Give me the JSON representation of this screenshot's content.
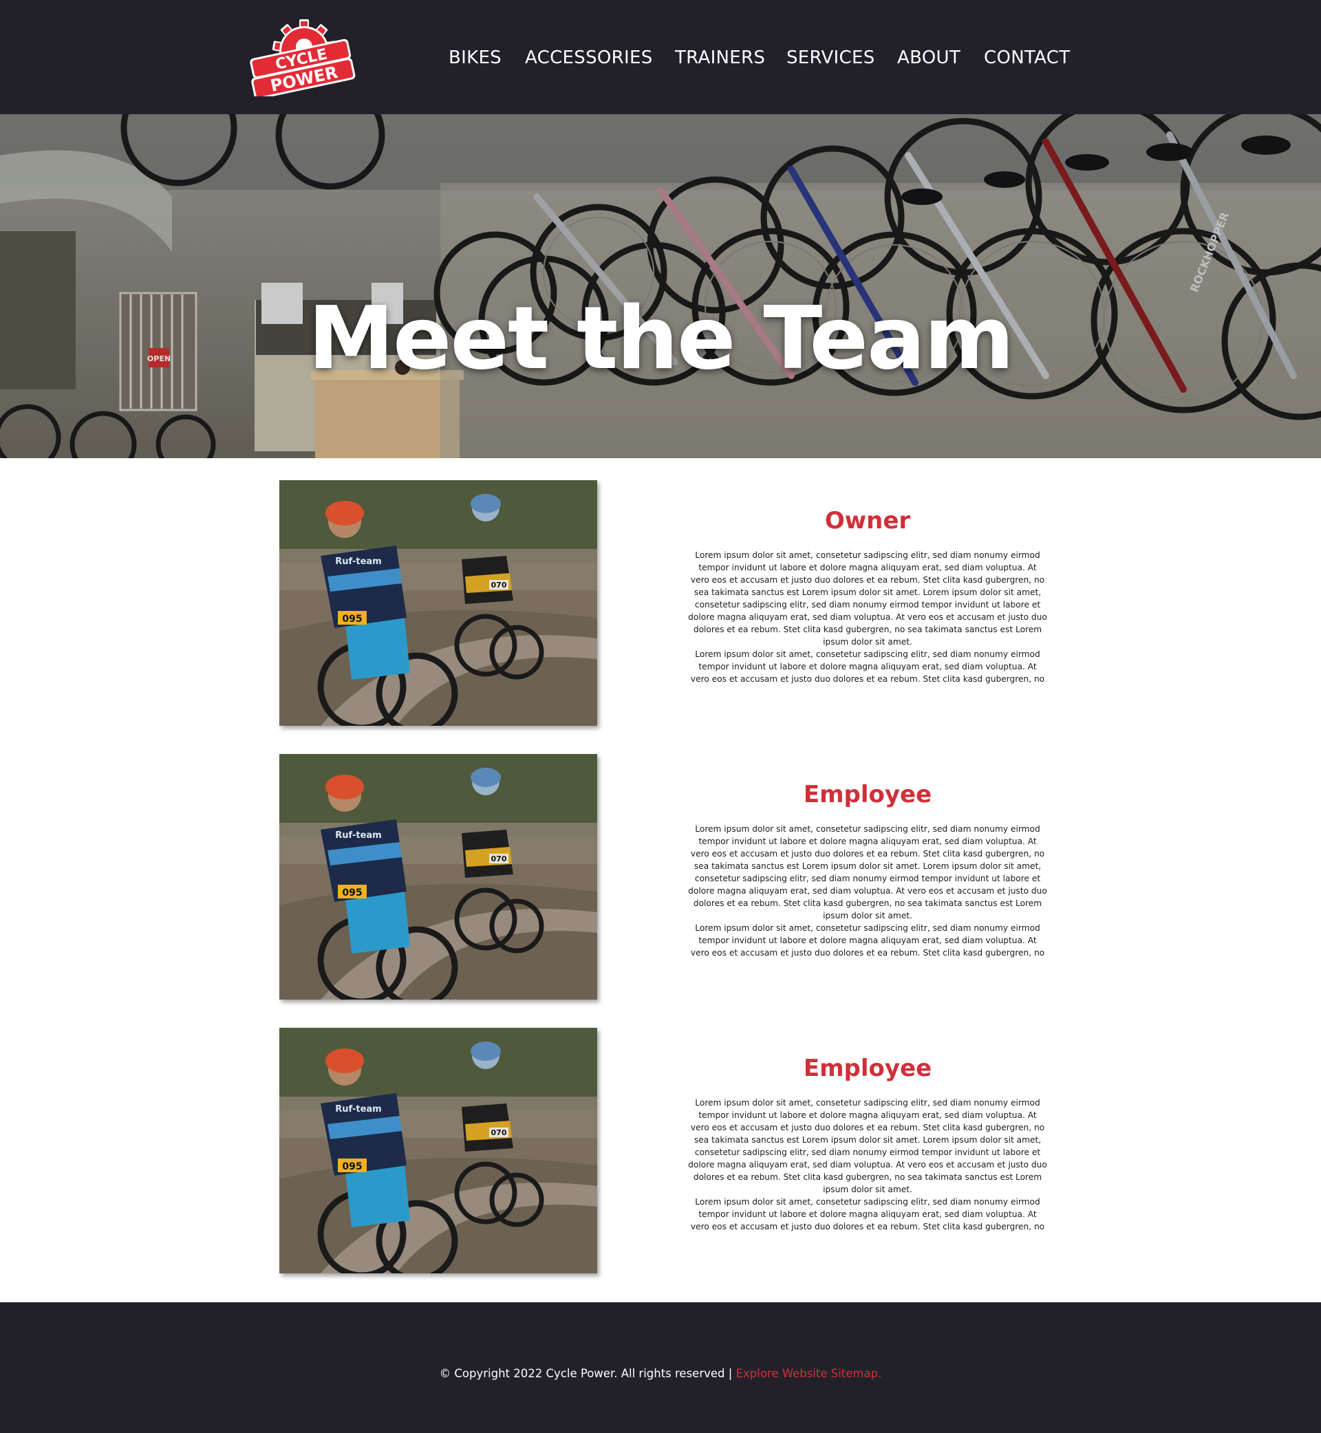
{
  "brand": {
    "logo_line1": "CYCLE",
    "logo_line2": "POWER",
    "color": "#e32b36"
  },
  "nav": {
    "items": [
      {
        "label": "BIKES"
      },
      {
        "label": "ACCESSORIES"
      },
      {
        "label": "TRAINERS"
      },
      {
        "label": "SERVICES"
      },
      {
        "label": "ABOUT"
      },
      {
        "label": "CONTACT"
      }
    ]
  },
  "hero": {
    "title": "Meet the Team",
    "sign_text": "OPEN",
    "rim_text": "ROCKHOPPER"
  },
  "team": [
    {
      "role": "Owner",
      "rider1_plate": "095",
      "rider2_plate": "070",
      "jersey_text": "Ruf-team",
      "bio": "Lorem ipsum dolor sit amet, consetetur sadipscing elitr, sed diam nonumy eirmod tempor invidunt ut labore et dolore magna aliquyam erat, sed diam voluptua. At vero eos et accusam et justo duo dolores et ea rebum. Stet clita kasd gubergren, no sea takimata sanctus est Lorem ipsum dolor sit amet. Lorem ipsum dolor sit amet, consetetur sadipscing elitr, sed diam nonumy eirmod tempor invidunt ut labore et dolore magna aliquyam erat, sed diam voluptua. At vero eos et accusam et justo duo dolores et ea rebum. Stet clita kasd gubergren, no sea takimata sanctus est Lorem ipsum dolor sit amet.",
      "bio2": "Lorem ipsum dolor sit amet, consetetur sadipscing elitr, sed diam nonumy eirmod tempor invidunt ut labore et dolore magna aliquyam erat, sed diam voluptua. At vero eos et accusam et justo duo dolores et ea rebum. Stet clita kasd gubergren, no"
    },
    {
      "role": "Employee",
      "rider1_plate": "095",
      "rider2_plate": "070",
      "jersey_text": "Ruf-team",
      "bio": "Lorem ipsum dolor sit amet, consetetur sadipscing elitr, sed diam nonumy eirmod tempor invidunt ut labore et dolore magna aliquyam erat, sed diam voluptua. At vero eos et accusam et justo duo dolores et ea rebum. Stet clita kasd gubergren, no sea takimata sanctus est Lorem ipsum dolor sit amet. Lorem ipsum dolor sit amet, consetetur sadipscing elitr, sed diam nonumy eirmod tempor invidunt ut labore et dolore magna aliquyam erat, sed diam voluptua. At vero eos et accusam et justo duo dolores et ea rebum. Stet clita kasd gubergren, no sea takimata sanctus est Lorem ipsum dolor sit amet.",
      "bio2": "Lorem ipsum dolor sit amet, consetetur sadipscing elitr, sed diam nonumy eirmod tempor invidunt ut labore et dolore magna aliquyam erat, sed diam voluptua. At vero eos et accusam et justo duo dolores et ea rebum. Stet clita kasd gubergren, no"
    },
    {
      "role": "Employee",
      "rider1_plate": "095",
      "rider2_plate": "070",
      "jersey_text": "Ruf-team",
      "bio": "Lorem ipsum dolor sit amet, consetetur sadipscing elitr, sed diam nonumy eirmod tempor invidunt ut labore et dolore magna aliquyam erat, sed diam voluptua. At vero eos et accusam et justo duo dolores et ea rebum. Stet clita kasd gubergren, no sea takimata sanctus est Lorem ipsum dolor sit amet. Lorem ipsum dolor sit amet, consetetur sadipscing elitr, sed diam nonumy eirmod tempor invidunt ut labore et dolore magna aliquyam erat, sed diam voluptua. At vero eos et accusam et justo duo dolores et ea rebum. Stet clita kasd gubergren, no sea takimata sanctus est Lorem ipsum dolor sit amet.",
      "bio2": "Lorem ipsum dolor sit amet, consetetur sadipscing elitr, sed diam nonumy eirmod tempor invidunt ut labore et dolore magna aliquyam erat, sed diam voluptua. At vero eos et accusam et justo duo dolores et ea rebum. Stet clita kasd gubergren, no"
    }
  ],
  "footer": {
    "copyright": "© Copyright 2022 Cycle Power. All rights reserved |",
    "sitemap_link": "Explore Website Sitemap."
  },
  "colors": {
    "header_bg": "#22212a",
    "accent": "#d12f38"
  }
}
